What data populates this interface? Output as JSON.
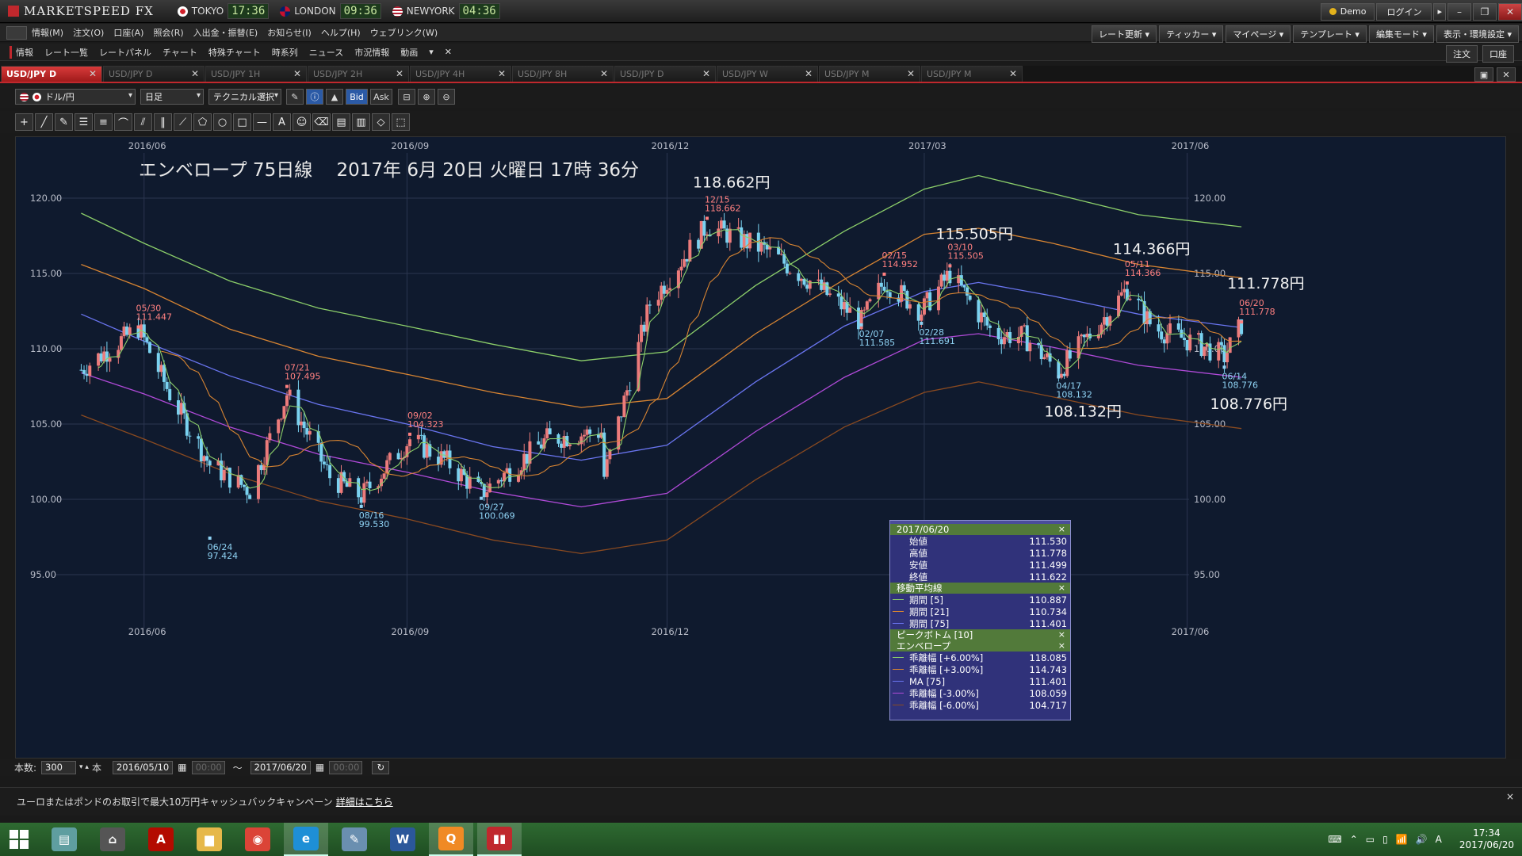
{
  "titlebar": {
    "app_name": "MARKETSPEED FX",
    "clocks": [
      {
        "city": "TOKYO",
        "time": "17:36",
        "flag": "jp"
      },
      {
        "city": "LONDON",
        "time": "09:36",
        "flag": "uk"
      },
      {
        "city": "NEWYORK",
        "time": "04:36",
        "flag": "us"
      }
    ],
    "demo_label": "Demo",
    "login_label": "ログイン",
    "login_arrow": "▸",
    "win_buttons": [
      "–",
      "❐",
      "✕"
    ]
  },
  "menubar": {
    "items": [
      "情報(M)",
      "注文(O)",
      "口座(A)",
      "照会(R)",
      "入出金・振替(E)",
      "お知らせ(I)",
      "ヘルプ(H)",
      "ウェブリンク(W)"
    ],
    "right_buttons": [
      "レート更新 ▾",
      "ティッカー ▾",
      "マイページ ▾",
      "テンプレート ▾",
      "編集モード ▾",
      "表示・環境設定 ▾"
    ]
  },
  "shortcutbar": {
    "items": [
      "情報",
      "レート一覧",
      "レートパネル",
      "チャート",
      "特殊チャート",
      "時系列",
      "ニュース",
      "市況情報",
      "動画"
    ],
    "dropdown_arrow": "▾",
    "close_glyph": "✕",
    "right_buttons": [
      "注文",
      "口座"
    ]
  },
  "tabs": [
    {
      "label": "USD/JPY D",
      "active": true
    },
    {
      "label": "USD/JPY D",
      "active": false
    },
    {
      "label": "USD/JPY 1H",
      "active": false
    },
    {
      "label": "USD/JPY 2H",
      "active": false
    },
    {
      "label": "USD/JPY 4H",
      "active": false
    },
    {
      "label": "USD/JPY 8H",
      "active": false
    },
    {
      "label": "USD/JPY D",
      "active": false
    },
    {
      "label": "USD/JPY W",
      "active": false
    },
    {
      "label": "USD/JPY M",
      "active": false
    },
    {
      "label": "USD/JPY M",
      "active": false
    }
  ],
  "tab_close": "✕",
  "tab_window_buttons": [
    "▣",
    "✕"
  ],
  "toolbar": {
    "pair": "ドル/円",
    "timeframe": "日足",
    "technical": "テクニカル選択",
    "bid": "Bid",
    "ask": "Ask",
    "select_arrow": "▾",
    "buttons": [
      "✎",
      "ⓘ",
      "▲"
    ],
    "zoom_buttons": [
      "⊟",
      "⊕",
      "⊖"
    ]
  },
  "draw_tools": [
    "+",
    "╱",
    "✎",
    "☰",
    "≡",
    "⌒",
    "⫽",
    "‖",
    "⟋",
    "⬠",
    "○",
    "□",
    "—",
    "A",
    "☺",
    "⌫",
    "▤",
    "▥",
    "◇",
    "⬚"
  ],
  "chart_data": {
    "type": "candlestick",
    "title": "エンベロープ 75日線　 2017年 6月 20日 火曜日 17時 36分",
    "x_ticks": [
      "2016/06",
      "2016/09",
      "2016/12",
      "2017/03",
      "2017/06"
    ],
    "y_ticks": [
      "120.00",
      "115.00",
      "110.00",
      "105.00",
      "100.00",
      "95.00"
    ],
    "ylim": [
      93,
      124
    ],
    "series": [
      {
        "name": "Envelope +6.00%",
        "color": "#8ccf6a",
        "points": [
          [
            "2016/05/10",
            119
          ],
          [
            "2016/06/01",
            117
          ],
          [
            "2016/07/01",
            114.5
          ],
          [
            "2016/08/01",
            112.7
          ],
          [
            "2016/09/01",
            111.5
          ],
          [
            "2016/10/01",
            110.3
          ],
          [
            "2016/11/01",
            109.2
          ],
          [
            "2016/12/01",
            109.8
          ],
          [
            "2017/01/01",
            114.2
          ],
          [
            "2017/02/01",
            117.8
          ],
          [
            "2017/03/01",
            120.6
          ],
          [
            "2017/03/20",
            121.5
          ],
          [
            "2017/04/15",
            120.3
          ],
          [
            "2017/05/15",
            118.9
          ],
          [
            "2017/06/20",
            118.1
          ]
        ]
      },
      {
        "name": "Envelope +3.00%",
        "color": "#d78432",
        "points": [
          [
            "2016/05/10",
            115.6
          ],
          [
            "2016/06/01",
            114
          ],
          [
            "2016/07/01",
            111.3
          ],
          [
            "2016/08/01",
            109.5
          ],
          [
            "2016/09/01",
            108.3
          ],
          [
            "2016/10/01",
            107.1
          ],
          [
            "2016/11/01",
            106.1
          ],
          [
            "2016/12/01",
            106.7
          ],
          [
            "2017/01/01",
            111
          ],
          [
            "2017/02/01",
            114.6
          ],
          [
            "2017/03/01",
            117.6
          ],
          [
            "2017/03/20",
            118
          ],
          [
            "2017/04/15",
            117
          ],
          [
            "2017/05/15",
            115.6
          ],
          [
            "2017/06/20",
            114.7
          ]
        ]
      },
      {
        "name": "MA [75]",
        "color": "#6a75f0",
        "points": [
          [
            "2016/05/10",
            112.3
          ],
          [
            "2016/06/01",
            110.5
          ],
          [
            "2016/07/01",
            108.2
          ],
          [
            "2016/08/01",
            106.3
          ],
          [
            "2016/09/01",
            105
          ],
          [
            "2016/10/01",
            103.5
          ],
          [
            "2016/11/01",
            102.6
          ],
          [
            "2016/12/01",
            103.6
          ],
          [
            "2017/01/01",
            107.8
          ],
          [
            "2017/02/01",
            111.5
          ],
          [
            "2017/03/01",
            113.8
          ],
          [
            "2017/03/20",
            114.4
          ],
          [
            "2017/04/15",
            113.5
          ],
          [
            "2017/05/15",
            112.3
          ],
          [
            "2017/06/20",
            111.4
          ]
        ]
      },
      {
        "name": "Envelope -3.00%",
        "color": "#b04ad8",
        "points": [
          [
            "2016/05/10",
            108.4
          ],
          [
            "2016/06/01",
            107
          ],
          [
            "2016/07/01",
            104.8
          ],
          [
            "2016/08/01",
            103
          ],
          [
            "2016/09/01",
            101.8
          ],
          [
            "2016/10/01",
            100.5
          ],
          [
            "2016/11/01",
            99.5
          ],
          [
            "2016/12/01",
            100.4
          ],
          [
            "2017/01/01",
            104.5
          ],
          [
            "2017/02/01",
            108.1
          ],
          [
            "2017/03/01",
            110.6
          ],
          [
            "2017/03/20",
            111
          ],
          [
            "2017/04/15",
            110.1
          ],
          [
            "2017/05/15",
            108.9
          ],
          [
            "2017/06/20",
            108.1
          ]
        ]
      },
      {
        "name": "Envelope -6.00%",
        "color": "#8a4a20",
        "points": [
          [
            "2016/05/10",
            105.6
          ],
          [
            "2016/06/01",
            104
          ],
          [
            "2016/07/01",
            101.7
          ],
          [
            "2016/08/01",
            99.9
          ],
          [
            "2016/09/01",
            98.7
          ],
          [
            "2016/10/01",
            97.3
          ],
          [
            "2016/11/01",
            96.4
          ],
          [
            "2016/12/01",
            97.3
          ],
          [
            "2017/01/01",
            101.3
          ],
          [
            "2017/02/01",
            104.8
          ],
          [
            "2017/03/01",
            107.1
          ],
          [
            "2017/03/20",
            107.8
          ],
          [
            "2017/04/15",
            106.8
          ],
          [
            "2017/05/15",
            105.6
          ],
          [
            "2017/06/20",
            104.7
          ]
        ]
      }
    ],
    "price_path": [
      [
        "2016/05/10",
        108.6
      ],
      [
        "2016/05/30",
        111.4
      ],
      [
        "2016/06/10",
        107
      ],
      [
        "2016/06/24",
        102.3
      ],
      [
        "2016/07/08",
        100.6
      ],
      [
        "2016/07/21",
        107
      ],
      [
        "2016/08/05",
        101.5
      ],
      [
        "2016/08/16",
        100.2
      ],
      [
        "2016/09/02",
        104
      ],
      [
        "2016/09/15",
        102.5
      ],
      [
        "2016/09/27",
        100.4
      ],
      [
        "2016/10/20",
        104
      ],
      [
        "2016/11/08",
        104.5
      ],
      [
        "2016/11/09",
        101.5
      ],
      [
        "2016/11/25",
        113
      ],
      [
        "2016/12/15",
        118.2
      ],
      [
        "2017/01/05",
        116.5
      ],
      [
        "2017/01/20",
        114.5
      ],
      [
        "2017/02/07",
        111.8
      ],
      [
        "2017/02/15",
        114.5
      ],
      [
        "2017/02/28",
        112.5
      ],
      [
        "2017/03/10",
        115
      ],
      [
        "2017/03/25",
        111
      ],
      [
        "2017/04/05",
        110.8
      ],
      [
        "2017/04/17",
        108.5
      ],
      [
        "2017/05/01",
        111.6
      ],
      [
        "2017/05/11",
        114
      ],
      [
        "2017/05/20",
        111.4
      ],
      [
        "2017/06/05",
        110.3
      ],
      [
        "2017/06/14",
        109.5
      ],
      [
        "2017/06/20",
        111.6
      ]
    ],
    "peak_labels": [
      {
        "date_label": "05/30",
        "value": "111.447",
        "date": "2016/05/30",
        "price": 111.447,
        "kind": "high"
      },
      {
        "date_label": "06/24",
        "value": "97.424",
        "date": "2016/06/24",
        "price": 97.424,
        "kind": "low"
      },
      {
        "date_label": "07/21",
        "value": "107.495",
        "date": "2016/07/21",
        "price": 107.495,
        "kind": "high"
      },
      {
        "date_label": "08/16",
        "value": "99.530",
        "date": "2016/08/16",
        "price": 99.53,
        "kind": "low"
      },
      {
        "date_label": "09/02",
        "value": "104.323",
        "date": "2016/09/02",
        "price": 104.323,
        "kind": "high"
      },
      {
        "date_label": "09/27",
        "value": "100.069",
        "date": "2016/09/27",
        "price": 100.069,
        "kind": "low"
      },
      {
        "date_label": "12/15",
        "value": "118.662",
        "date": "2016/12/15",
        "price": 118.662,
        "kind": "high"
      },
      {
        "date_label": "02/07",
        "value": "111.585",
        "date": "2017/02/07",
        "price": 111.585,
        "kind": "low"
      },
      {
        "date_label": "02/15",
        "value": "114.952",
        "date": "2017/02/15",
        "price": 114.952,
        "kind": "high"
      },
      {
        "date_label": "02/28",
        "value": "111.691",
        "date": "2017/02/28",
        "price": 111.691,
        "kind": "low"
      },
      {
        "date_label": "03/10",
        "value": "115.505",
        "date": "2017/03/10",
        "price": 115.505,
        "kind": "high"
      },
      {
        "date_label": "04/17",
        "value": "108.132",
        "date": "2017/04/17",
        "price": 108.132,
        "kind": "low"
      },
      {
        "date_label": "05/11",
        "value": "114.366",
        "date": "2017/05/11",
        "price": 114.366,
        "kind": "high"
      },
      {
        "date_label": "06/14",
        "value": "108.776",
        "date": "2017/06/14",
        "price": 108.776,
        "kind": "low"
      },
      {
        "date_label": "06/20",
        "value": "111.778",
        "date": "2017/06/20",
        "price": 111.778,
        "kind": "high"
      }
    ],
    "annotations": [
      {
        "text": "118.662円",
        "date": "2016/12/15",
        "price": 120.7
      },
      {
        "text": "115.505円",
        "date": "2017/03/10",
        "price": 117.3
      },
      {
        "text": "114.366円",
        "date": "2017/05/11",
        "price": 116.3
      },
      {
        "text": "111.778円",
        "date": "2017/06/20",
        "price": 114.0
      },
      {
        "text": "108.132円",
        "date": "2017/04/17",
        "price": 105.5
      },
      {
        "text": "108.776円",
        "date": "2017/06/14",
        "price": 106.0
      }
    ]
  },
  "info_panel": {
    "date": "2017/06/20",
    "close_glyph": "×",
    "ohlc": [
      {
        "label": "始値",
        "value": "111.530"
      },
      {
        "label": "高値",
        "value": "111.778"
      },
      {
        "label": "安値",
        "value": "111.499"
      },
      {
        "label": "終値",
        "value": "111.622"
      }
    ],
    "ma_title": "移動平均線",
    "ma": [
      {
        "label": "期間 [5]",
        "value": "110.887",
        "color": "#8ccf6a"
      },
      {
        "label": "期間 [21]",
        "value": "110.734",
        "color": "#d78432"
      },
      {
        "label": "期間 [75]",
        "value": "111.401",
        "color": "#6a75f0"
      }
    ],
    "peak_title": "ピークボトム [10]",
    "env_title": "エンベロープ",
    "env": [
      {
        "label": "乖離幅 [+6.00%]",
        "value": "118.085",
        "color": "#8ccf6a"
      },
      {
        "label": "乖離幅 [+3.00%]",
        "value": "114.743",
        "color": "#d78432"
      },
      {
        "label": "MA [75]",
        "value": "111.401",
        "color": "#6a75f0"
      },
      {
        "label": "乖離幅 [-3.00%]",
        "value": "108.059",
        "color": "#b04ad8"
      },
      {
        "label": "乖離幅 [-6.00%]",
        "value": "104.717",
        "color": "#8a4a20"
      }
    ]
  },
  "rangebar": {
    "count_label": "本数:",
    "count_value": "300",
    "count_unit": "本",
    "spin_glyph": "▾ ▴",
    "start_date": "2016/05/10",
    "start_time": "00:00",
    "tilde": "～",
    "end_date": "2017/06/20",
    "end_time": "00:00",
    "calendar_glyph": "▦",
    "reload_glyph": "↻"
  },
  "banner": {
    "text": "ユーロまたはポンドのお取引で最大10万円キャッシュバックキャンペーン",
    "link": "詳細はこちら",
    "close_glyph": "×"
  },
  "taskbar": {
    "apps": [
      {
        "name": "explorer",
        "glyph": "▤",
        "color": "#5f9ea0",
        "active": false
      },
      {
        "name": "network",
        "glyph": "⌂",
        "color": "#555555",
        "active": false
      },
      {
        "name": "acrobat",
        "glyph": "A",
        "color": "#b30b00",
        "active": false
      },
      {
        "name": "folder",
        "glyph": "▆",
        "color": "#e6b84a",
        "active": false
      },
      {
        "name": "chrome",
        "glyph": "◉",
        "color": "#db4437",
        "active": false
      },
      {
        "name": "ie",
        "glyph": "e",
        "color": "#1e8fd6",
        "active": true
      },
      {
        "name": "paint",
        "glyph": "✎",
        "color": "#6a8fb0",
        "active": false
      },
      {
        "name": "word",
        "glyph": "W",
        "color": "#2b579a",
        "active": false
      },
      {
        "name": "chat",
        "glyph": "Q",
        "color": "#f08a24",
        "active": true
      },
      {
        "name": "marketspeed",
        "glyph": "▮▮",
        "color": "#c0282d",
        "active": true
      }
    ],
    "tray_icons": [
      "⌨",
      "⌃",
      "▭",
      "▯",
      "📶",
      "🔊",
      "A"
    ],
    "time": "17:34",
    "date": "2017/06/20"
  }
}
